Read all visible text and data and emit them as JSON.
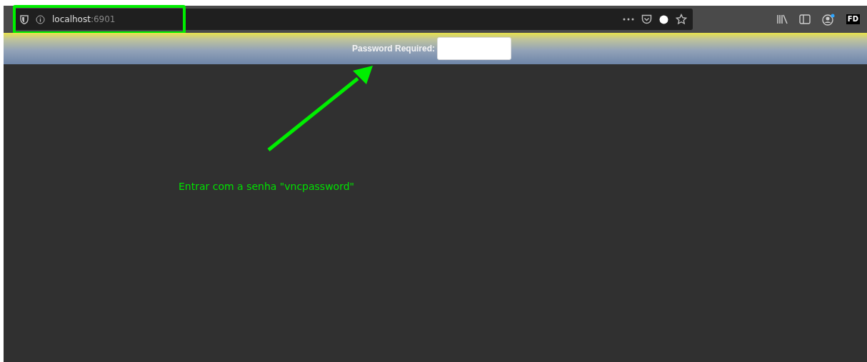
{
  "address_bar": {
    "host": "localhost",
    "port": ":6901"
  },
  "profile_badge": "FD",
  "password_bar": {
    "label": "Password Required:"
  },
  "annotation": {
    "text": "Entrar com a senha \"vncpassword\""
  }
}
